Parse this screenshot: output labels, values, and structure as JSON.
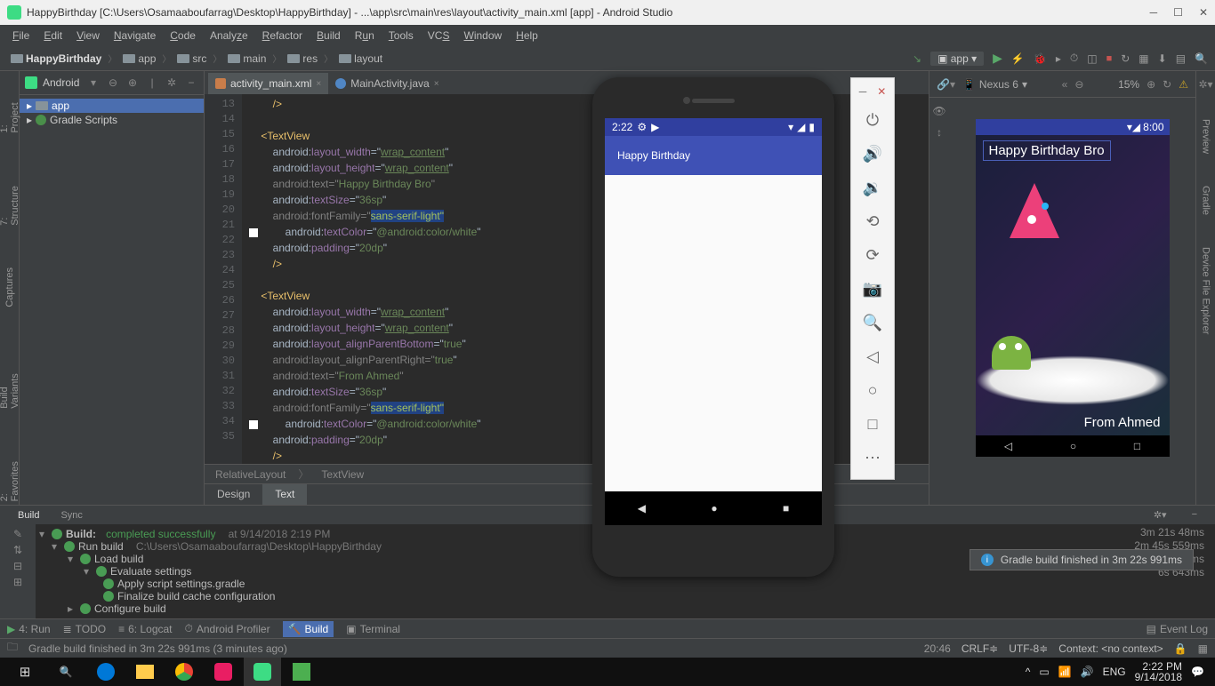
{
  "titlebar": {
    "text": "HappyBirthday [C:\\Users\\Osamaaboufarrag\\Desktop\\HappyBirthday] - ...\\app\\src\\main\\res\\layout\\activity_main.xml [app] - Android Studio"
  },
  "menu": {
    "file": "File",
    "edit": "Edit",
    "view": "View",
    "navigate": "Navigate",
    "code": "Code",
    "analyze": "Analyze",
    "refactor": "Refactor",
    "build": "Build",
    "run": "Run",
    "tools": "Tools",
    "vcs": "VCS",
    "window": "Window",
    "help": "Help"
  },
  "breadcrumbs": [
    "HappyBirthday",
    "app",
    "src",
    "main",
    "res",
    "layout"
  ],
  "runconfig": "app",
  "project": {
    "head": "Android",
    "app": "app",
    "gradle": "Gradle Scripts"
  },
  "tabs": {
    "xml": "activity_main.xml",
    "java": "MainActivity.java"
  },
  "code": {
    "lines": [
      13,
      14,
      15,
      16,
      17,
      18,
      19,
      20,
      21,
      22,
      23,
      24,
      25,
      26,
      27,
      28,
      29,
      30,
      31,
      32,
      33,
      34,
      35
    ],
    "l13": "        />",
    "l15": "    <TextView",
    "l16a": "        android:",
    "l16b": "layout_width",
    "l16c": "=\"",
    "l16d": "wrap_content",
    "l16e": "\"",
    "l17a": "        android:",
    "l17b": "layout_height",
    "l17c": "=\"",
    "l17d": "wrap_content",
    "l17e": "\"",
    "l18a": "        android",
    "l18b": ":text=\"",
    "l18c": "Happy Birthday Bro",
    "l18d": "\"",
    "l19a": "        android:",
    "l19b": "textSize",
    "l19c": "=\"",
    "l19d": "36sp",
    "l19e": "\"",
    "l20a": "        android",
    "l20b": ":fontFamily=\"",
    "l20c": "sans-serif-light",
    "l20d": "\"",
    "l21a": "        android:",
    "l21b": "textColor",
    "l21c": "=\"",
    "l21d": "@android:color/white",
    "l21e": "\"",
    "l22a": "        android:",
    "l22b": "padding",
    "l22c": "=\"",
    "l22d": "20dp",
    "l22e": "\"",
    "l23": "        />",
    "l25": "    <TextView",
    "l26a": "        android:",
    "l26b": "layout_width",
    "l26c": "=\"",
    "l26d": "wrap_content",
    "l26e": "\"",
    "l27a": "        android:",
    "l27b": "layout_height",
    "l27c": "=\"",
    "l27d": "wrap_content",
    "l27e": "\"",
    "l28a": "        android:",
    "l28b": "layout_alignParentBottom",
    "l28c": "=\"",
    "l28d": "true",
    "l28e": "\"",
    "l29a": "        android",
    "l29b": ":layout_alignParentRight=\"",
    "l29c": "true",
    "l29d": "\"",
    "l30a": "        android",
    "l30b": ":text=\"",
    "l30c": "From Ahmed",
    "l30d": "\"",
    "l31a": "        android:",
    "l31b": "textSize",
    "l31c": "=\"",
    "l31d": "36sp",
    "l31e": "\"",
    "l32a": "        android",
    "l32b": ":fontFamily=\"",
    "l32c": "sans-serif-light",
    "l32d": "\"",
    "l33a": "        android:",
    "l33b": "textColor",
    "l33c": "=\"",
    "l33d": "@android:color/white",
    "l33e": "\"",
    "l34a": "        android:",
    "l34b": "padding",
    "l34c": "=\"",
    "l34d": "20dp",
    "l34e": "\"",
    "l35": "        />"
  },
  "crumbs2": {
    "a": "RelativeLayout",
    "b": "TextView"
  },
  "dttabs": {
    "design": "Design",
    "text": "Text"
  },
  "emulator": {
    "time": "2:22",
    "appname": "Happy Birthday"
  },
  "preview": {
    "device": "Nexus 6",
    "zoom": "15%",
    "statTime": "8:00",
    "t1": "Happy Birthday Bro",
    "t2": "From Ahmed"
  },
  "build": {
    "tabs": {
      "build": "Build",
      "sync": "Sync"
    },
    "r1": "Build:",
    "r1b": "completed successfully",
    "r1c": "at 9/14/2018 2:19 PM",
    "t1": "3m 21s 48ms",
    "r2": "Run build",
    "r2b": "C:\\Users\\Osamaaboufarrag\\Desktop\\HappyBirthday",
    "t2": "2m 45s 559ms",
    "r3": "Load build",
    "t3": "6s 796ms",
    "r4": "Evaluate settings",
    "t4": "6s 643ms",
    "r5": "Apply script settings.gradle",
    "r6": "Finalize build cache configuration",
    "r7": "Configure build"
  },
  "toolwin": {
    "run": "4: Run",
    "todo": "TODO",
    "logcat": "6: Logcat",
    "profiler": "Android Profiler",
    "build": "Build",
    "terminal": "Terminal",
    "eventlog": "Event Log"
  },
  "status": {
    "msg": "Gradle build finished in 3m 22s 991ms (3 minutes ago)",
    "time": "20:46",
    "crlf": "CRLF",
    "enc": "UTF-8",
    "ctx": "Context: <no context>"
  },
  "toast": "Gradle build finished in 3m 22s 991ms",
  "taskbar": {
    "lang": "ENG",
    "time": "2:22 PM",
    "date": "9/14/2018"
  }
}
